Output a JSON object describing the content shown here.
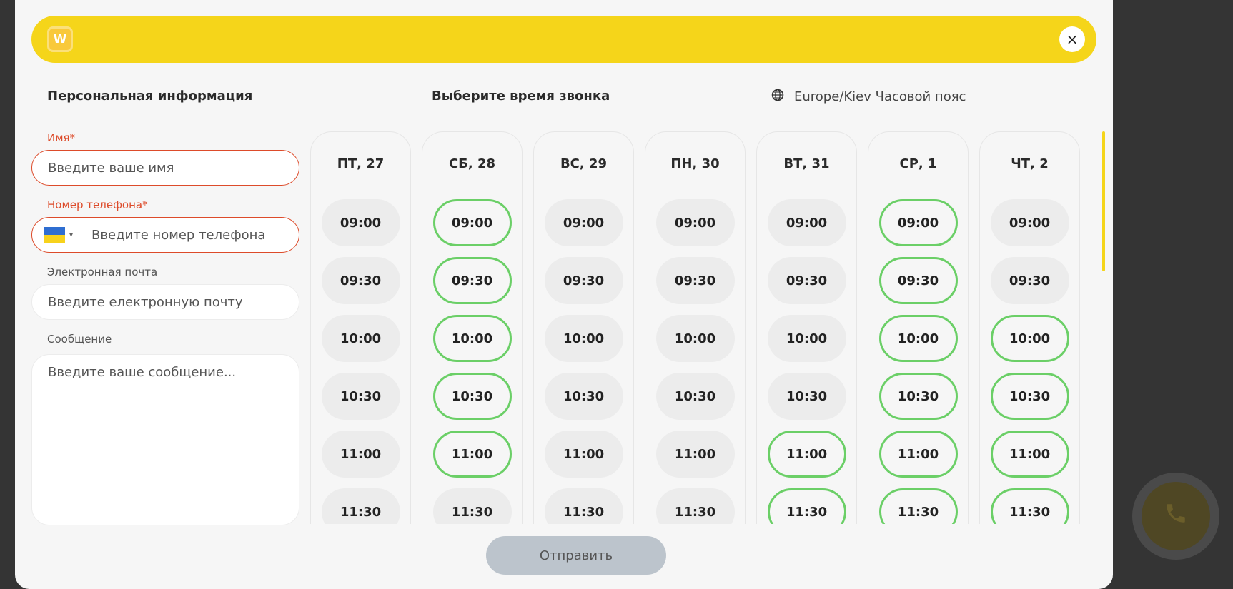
{
  "header": {
    "logo_letter": "W",
    "close_symbol": "×"
  },
  "personal": {
    "title": "Персональная информация",
    "name_label": "Имя*",
    "name_placeholder": "Введите ваше имя",
    "phone_label": "Номер телефона*",
    "phone_placeholder": "Введите номер телефона",
    "phone_country": "UA",
    "email_label": "Электронная почта",
    "email_placeholder": "Введите електронную почту",
    "message_label": "Сообщение",
    "message_placeholder": "Введите ваше сообщение..."
  },
  "schedule": {
    "title": "Выберите время звонка",
    "timezone": "Europe/Kiev Часовой пояс",
    "days": [
      {
        "label": "ПТ, 27",
        "slots": [
          {
            "time": "09:00",
            "available": false
          },
          {
            "time": "09:30",
            "available": false
          },
          {
            "time": "10:00",
            "available": false
          },
          {
            "time": "10:30",
            "available": false
          },
          {
            "time": "11:00",
            "available": false
          },
          {
            "time": "11:30",
            "available": false
          }
        ]
      },
      {
        "label": "СБ, 28",
        "slots": [
          {
            "time": "09:00",
            "available": true
          },
          {
            "time": "09:30",
            "available": true
          },
          {
            "time": "10:00",
            "available": true
          },
          {
            "time": "10:30",
            "available": true
          },
          {
            "time": "11:00",
            "available": true
          },
          {
            "time": "11:30",
            "available": false
          }
        ]
      },
      {
        "label": "ВС, 29",
        "slots": [
          {
            "time": "09:00",
            "available": false
          },
          {
            "time": "09:30",
            "available": false
          },
          {
            "time": "10:00",
            "available": false
          },
          {
            "time": "10:30",
            "available": false
          },
          {
            "time": "11:00",
            "available": false
          },
          {
            "time": "11:30",
            "available": false
          }
        ]
      },
      {
        "label": "ПН, 30",
        "slots": [
          {
            "time": "09:00",
            "available": false
          },
          {
            "time": "09:30",
            "available": false
          },
          {
            "time": "10:00",
            "available": false
          },
          {
            "time": "10:30",
            "available": false
          },
          {
            "time": "11:00",
            "available": false
          },
          {
            "time": "11:30",
            "available": false
          }
        ]
      },
      {
        "label": "ВТ, 31",
        "slots": [
          {
            "time": "09:00",
            "available": false
          },
          {
            "time": "09:30",
            "available": false
          },
          {
            "time": "10:00",
            "available": false
          },
          {
            "time": "10:30",
            "available": false
          },
          {
            "time": "11:00",
            "available": true
          },
          {
            "time": "11:30",
            "available": true
          }
        ]
      },
      {
        "label": "СР, 1",
        "slots": [
          {
            "time": "09:00",
            "available": true
          },
          {
            "time": "09:30",
            "available": true
          },
          {
            "time": "10:00",
            "available": true
          },
          {
            "time": "10:30",
            "available": true
          },
          {
            "time": "11:00",
            "available": true
          },
          {
            "time": "11:30",
            "available": true
          }
        ]
      },
      {
        "label": "ЧТ, 2",
        "slots": [
          {
            "time": "09:00",
            "available": false
          },
          {
            "time": "09:30",
            "available": false
          },
          {
            "time": "10:00",
            "available": true
          },
          {
            "time": "10:30",
            "available": true
          },
          {
            "time": "11:00",
            "available": true
          },
          {
            "time": "11:30",
            "available": true
          }
        ]
      }
    ]
  },
  "submit_label": "Отправить",
  "colors": {
    "accent": "#f5d51a",
    "available_border": "#6bcf67",
    "error": "#dd4b2a",
    "submit_bg": "#bcc4cc"
  }
}
